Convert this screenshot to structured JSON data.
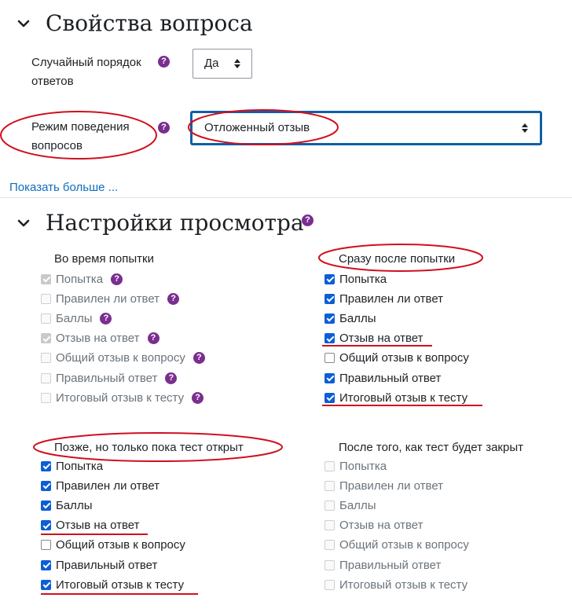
{
  "question_props": {
    "title": "Свойства вопроса",
    "shuffle_label": "Случайный порядок ответов",
    "shuffle_value": "Да",
    "behaviour_label": "Режим поведения вопросов",
    "behaviour_value": "Отложенный отзыв",
    "show_more": "Показать больше ..."
  },
  "review": {
    "title": "Настройки просмотра",
    "columns": [
      {
        "heading": "Во время попытки",
        "options": [
          {
            "label": "Попытка",
            "state": "checked-disabled",
            "help": true
          },
          {
            "label": "Правилен ли ответ",
            "state": "disabled",
            "help": true
          },
          {
            "label": "Баллы",
            "state": "disabled",
            "help": true
          },
          {
            "label": "Отзыв на ответ",
            "state": "checked-disabled",
            "help": true
          },
          {
            "label": "Общий отзыв к вопросу",
            "state": "disabled",
            "help": true
          },
          {
            "label": "Правильный ответ",
            "state": "disabled",
            "help": true
          },
          {
            "label": "Итоговый отзыв к тесту",
            "state": "disabled",
            "help": true
          }
        ]
      },
      {
        "heading": "Сразу после попытки",
        "options": [
          {
            "label": "Попытка",
            "state": "checked"
          },
          {
            "label": "Правилен ли ответ",
            "state": "checked"
          },
          {
            "label": "Баллы",
            "state": "checked"
          },
          {
            "label": "Отзыв на ответ",
            "state": "checked"
          },
          {
            "label": "Общий отзыв к вопросу",
            "state": "unchecked"
          },
          {
            "label": "Правильный ответ",
            "state": "checked"
          },
          {
            "label": "Итоговый отзыв к тесту",
            "state": "checked"
          }
        ]
      },
      {
        "heading": "Позже, но только пока тест открыт",
        "options": [
          {
            "label": "Попытка",
            "state": "checked"
          },
          {
            "label": "Правилен ли ответ",
            "state": "checked"
          },
          {
            "label": "Баллы",
            "state": "checked"
          },
          {
            "label": "Отзыв на ответ",
            "state": "checked"
          },
          {
            "label": "Общий отзыв к вопросу",
            "state": "unchecked"
          },
          {
            "label": "Правильный ответ",
            "state": "checked"
          },
          {
            "label": "Итоговый отзыв к тесту",
            "state": "checked"
          }
        ]
      },
      {
        "heading": "После того, как тест будет закрыт",
        "options": [
          {
            "label": "Попытка",
            "state": "disabled"
          },
          {
            "label": "Правилен ли ответ",
            "state": "disabled"
          },
          {
            "label": "Баллы",
            "state": "disabled"
          },
          {
            "label": "Отзыв на ответ",
            "state": "disabled"
          },
          {
            "label": "Общий отзыв к вопросу",
            "state": "disabled"
          },
          {
            "label": "Правильный ответ",
            "state": "disabled"
          },
          {
            "label": "Итоговый отзыв к тесту",
            "state": "disabled"
          }
        ]
      }
    ]
  },
  "colors": {
    "help_icon": "#7a2e8f",
    "checkbox_checked": "#0b5ed7",
    "link": "#0f6cbf",
    "annotation": "#d0101e",
    "focused_select_border": "#0f5fa8"
  }
}
